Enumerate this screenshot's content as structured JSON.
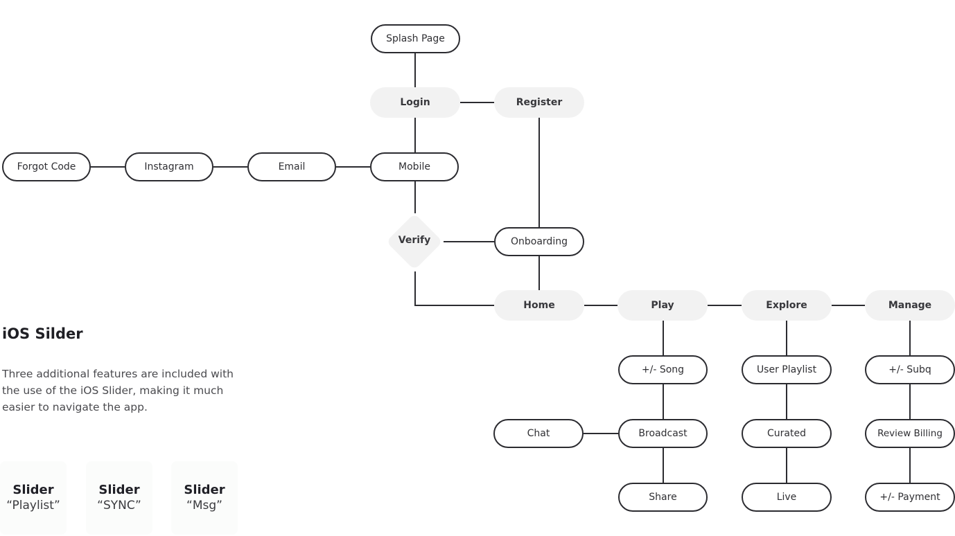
{
  "diagram": {
    "nodes": {
      "splash": "Splash Page",
      "login": "Login",
      "register": "Register",
      "forgot_code": "Forgot Code",
      "instagram": "Instagram",
      "email": "Email",
      "mobile": "Mobile",
      "verify": "Verify",
      "onboarding": "Onboarding",
      "home": "Home",
      "play": "Play",
      "explore": "Explore",
      "manage": "Manage",
      "song": "+/- Song",
      "broadcast": "Broadcast",
      "chat": "Chat",
      "share": "Share",
      "user_playlist": "User Playlist",
      "curated": "Curated",
      "live": "Live",
      "subq": "+/- Subq",
      "review_billing": "Review Billing",
      "payment": "+/- Payment"
    },
    "edges": [
      [
        "splash",
        "login"
      ],
      [
        "login",
        "register"
      ],
      [
        "login",
        "mobile"
      ],
      [
        "register",
        "onboarding"
      ],
      [
        "forgot_code",
        "instagram"
      ],
      [
        "instagram",
        "email"
      ],
      [
        "email",
        "mobile"
      ],
      [
        "mobile",
        "verify"
      ],
      [
        "verify",
        "onboarding"
      ],
      [
        "verify",
        "home"
      ],
      [
        "onboarding",
        "home"
      ],
      [
        "home",
        "play"
      ],
      [
        "play",
        "explore"
      ],
      [
        "explore",
        "manage"
      ],
      [
        "play",
        "song"
      ],
      [
        "song",
        "broadcast"
      ],
      [
        "chat",
        "broadcast"
      ],
      [
        "broadcast",
        "share"
      ],
      [
        "explore",
        "user_playlist"
      ],
      [
        "user_playlist",
        "curated"
      ],
      [
        "curated",
        "live"
      ],
      [
        "manage",
        "subq"
      ],
      [
        "subq",
        "review_billing"
      ],
      [
        "review_billing",
        "payment"
      ]
    ]
  },
  "sidebar": {
    "title": "iOS Silder",
    "description": "Three additional features are included with the use of the iOS Slider, making it much easier to navigate the app.",
    "sliders": [
      {
        "title": "Slider",
        "subtitle": "“Playlist”"
      },
      {
        "title": "Slider",
        "subtitle": "“SYNC”"
      },
      {
        "title": "Slider",
        "subtitle": "“Msg”"
      }
    ]
  }
}
